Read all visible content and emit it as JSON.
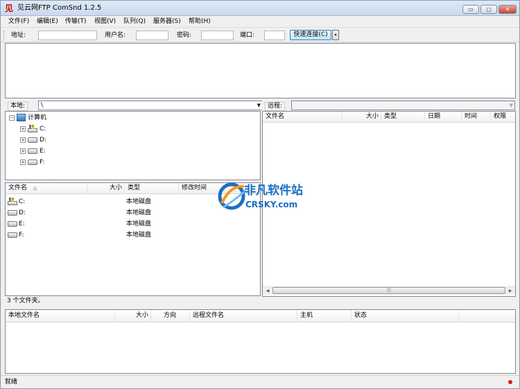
{
  "window": {
    "title": "见云网FTP ComSnd 1.2.5",
    "app_glyph": "见",
    "min_glyph": "▭",
    "max_glyph": "▢",
    "close_glyph": "✕"
  },
  "menu": [
    "文件(F)",
    "编辑(E)",
    "传输(T)",
    "视图(V)",
    "队列(Q)",
    "服务器(S)",
    "帮助(H)"
  ],
  "quickconnect": {
    "host_label": "地址:",
    "host_value": "",
    "user_label": "用户名:",
    "user_value": "",
    "pass_label": "密码:",
    "pass_value": "",
    "port_label": "端口:",
    "port_value": "",
    "button_label": "快速连接(C)",
    "dropdown_glyph": "▾"
  },
  "local": {
    "path_label": "本地:",
    "path_value": "\\",
    "tree": {
      "root": "计算机",
      "drives": [
        "C:",
        "D:",
        "E:",
        "F:"
      ]
    },
    "columns": [
      "文件名",
      "大小",
      "类型",
      "修改时间"
    ],
    "sort_indicator": "△",
    "files": [
      {
        "name": "C:",
        "size": "",
        "type": "本地磁盘",
        "modified": "",
        "icon": "system-drive-icon"
      },
      {
        "name": "D:",
        "size": "",
        "type": "本地磁盘",
        "modified": "",
        "icon": "drive-icon"
      },
      {
        "name": "E:",
        "size": "",
        "type": "本地磁盘",
        "modified": "",
        "icon": "drive-icon"
      },
      {
        "name": "F:",
        "size": "",
        "type": "本地磁盘",
        "modified": "",
        "icon": "drive-icon"
      }
    ],
    "status": "3 个文件夹。"
  },
  "remote": {
    "path_label": "远程:",
    "path_value": "",
    "columns": [
      "文件名",
      "大小",
      "类型",
      "日期",
      "时间",
      "权限"
    ],
    "scroll_grip": "|||"
  },
  "queue": {
    "columns": [
      "本地文件名",
      "大小",
      "方向",
      "远程文件名",
      "主机",
      "状态"
    ]
  },
  "statusbar": {
    "text": "就绪"
  },
  "watermark": {
    "line1": "非凡软件站",
    "line2": "CRSKY.com"
  },
  "colors": {
    "accent": "#3c7fb1",
    "title_gradient": "#c9d9ee",
    "close": "#c4462a",
    "watermark_blue": "#1a6fc4",
    "watermark_orange": "#f29a1b"
  }
}
